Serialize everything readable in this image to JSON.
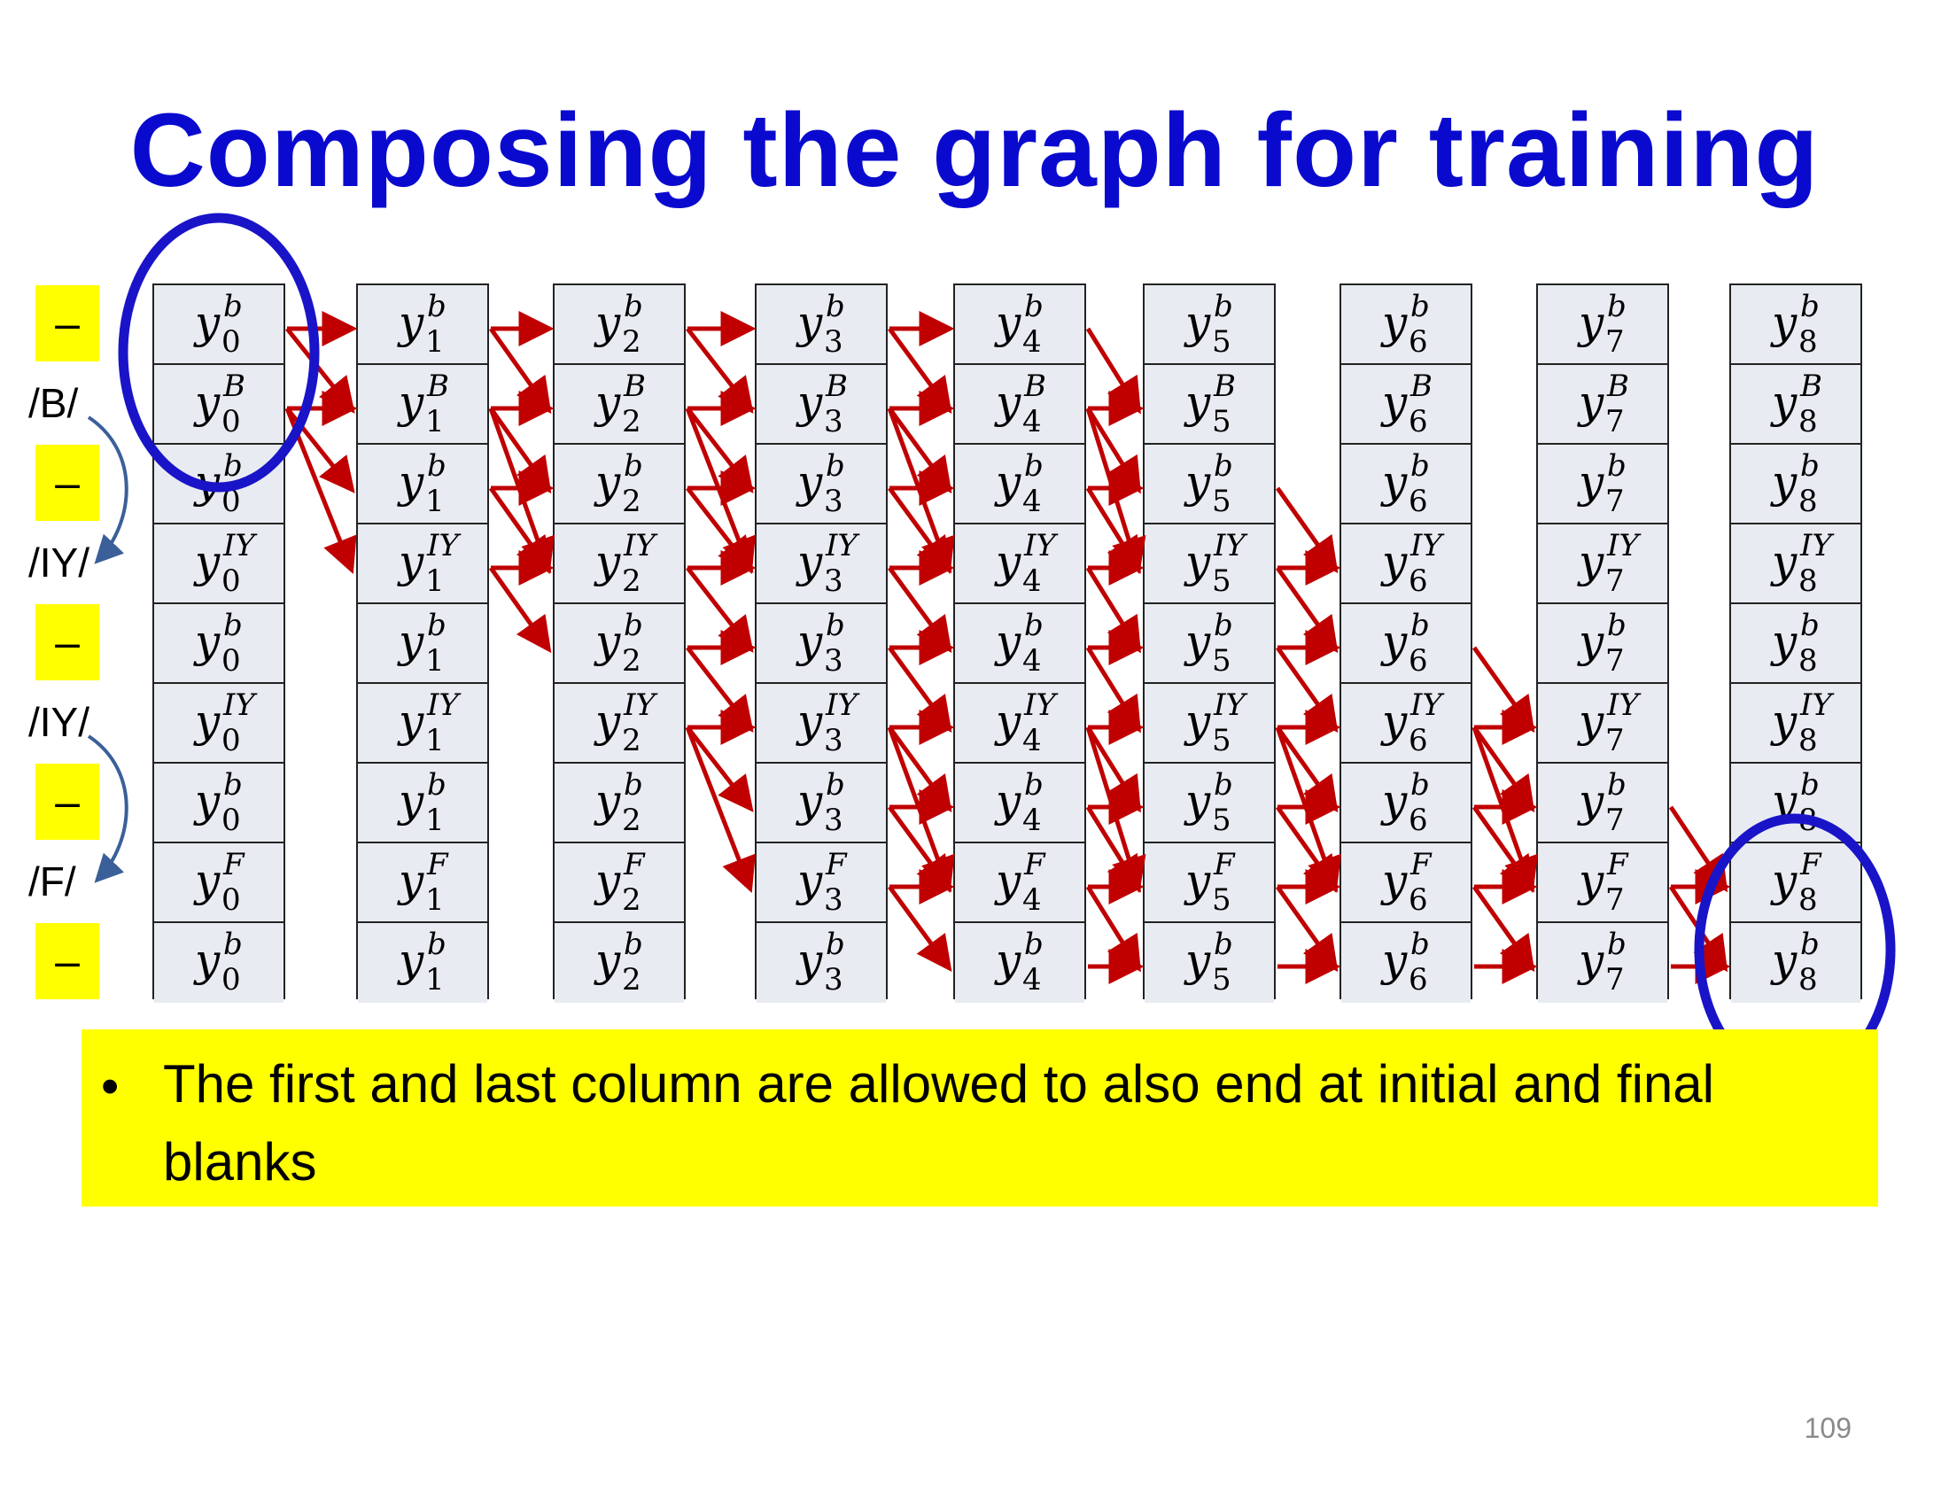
{
  "title": "Composing the graph for training",
  "row_labels": [
    "–",
    "/B/",
    "–",
    "/IY/",
    "–",
    "/IY/",
    "–",
    "/F/",
    "–"
  ],
  "row_symbols": [
    "b",
    "B",
    "b",
    "IY",
    "b",
    "IY",
    "b",
    "F",
    "b"
  ],
  "base_symbol": "y",
  "columns": [
    "0",
    "1",
    "2",
    "3",
    "4",
    "5",
    "6",
    "7",
    "8"
  ],
  "note": "The first and last column are allowed to also end at initial and final blanks",
  "bullet": "•",
  "page_number": "109",
  "colors": {
    "title": "#0A0ACF",
    "arrow": "#C00000",
    "highlight_circle": "#1A14C8",
    "note_bg": "#FFFF00",
    "cell_bg": "#E8ECF2",
    "label_arc": "#3B5F99"
  }
}
